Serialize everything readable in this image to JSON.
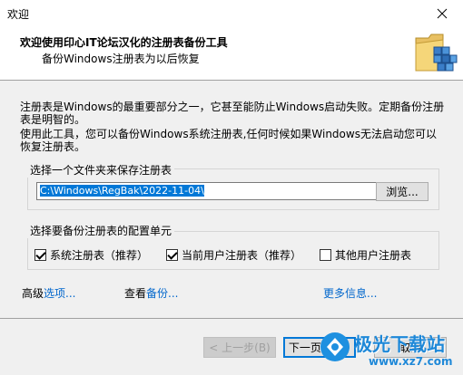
{
  "window": {
    "title": "欢迎"
  },
  "header": {
    "title": "欢迎使用印心IT论坛汉化的注册表备份工具",
    "subtitle": "备份Windows注册表为以后恢复"
  },
  "intro": {
    "para1": "注册表是Windows的最重要部分之一，它甚至能防止Windows启动失败。定期备份注册表是明智的。",
    "para2": "使用此工具，您可以备份Windows系统注册表,任何时候如果Windows无法启动您可以恢复注册表。"
  },
  "folder_group": {
    "legend": "选择一个文件夹来保存注册表",
    "path_value": "C:\\Windows\\RegBak\\2022-11-04\\",
    "browse_label": "浏览..."
  },
  "config_group": {
    "legend": "选择要备份注册表的配置单元",
    "options": [
      {
        "label": "系统注册表（推荐）",
        "checked": true
      },
      {
        "label": "当前用户注册表（推荐）",
        "checked": true
      },
      {
        "label": "其他用户注册表",
        "checked": false
      }
    ]
  },
  "links": {
    "advanced_a": "高级",
    "advanced_b": "选项...",
    "view_a": "查看",
    "view_b": "备份...",
    "more_a": "更多",
    "more_b": "信息..."
  },
  "buttons": {
    "back": "< 上一步(B)",
    "next": "下一页(N) >",
    "cancel": "取消"
  },
  "watermark": {
    "name": "极光下载站",
    "url": "www.xz7.com"
  }
}
